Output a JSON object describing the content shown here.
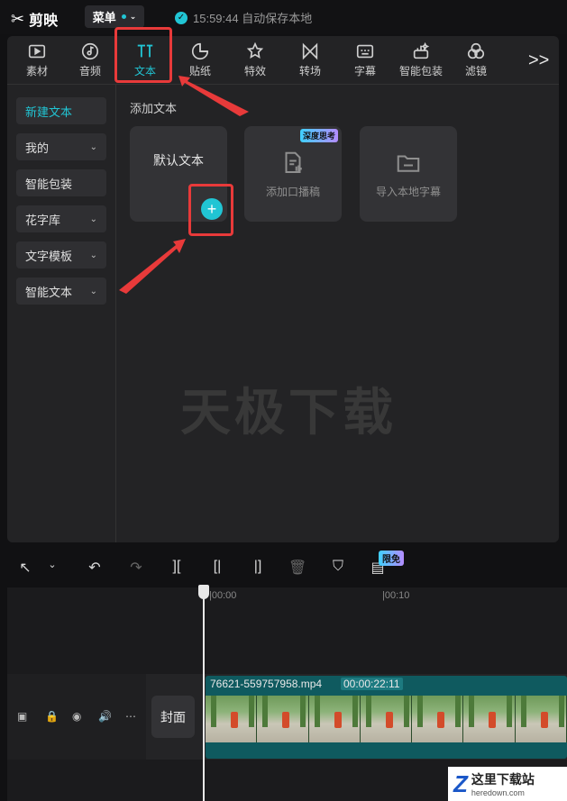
{
  "app": {
    "name": "剪映",
    "menu_label": "菜单",
    "save_status": "15:59:44 自动保存本地"
  },
  "toolbar": {
    "items": [
      {
        "label": "素材",
        "icon": "media-icon"
      },
      {
        "label": "音频",
        "icon": "audio-icon"
      },
      {
        "label": "文本",
        "icon": "text-icon",
        "active": true
      },
      {
        "label": "贴纸",
        "icon": "sticker-icon"
      },
      {
        "label": "特效",
        "icon": "effects-icon"
      },
      {
        "label": "转场",
        "icon": "transition-icon"
      },
      {
        "label": "字幕",
        "icon": "subtitle-icon"
      },
      {
        "label": "智能包装",
        "icon": "smart-pack-icon"
      },
      {
        "label": "滤镜",
        "icon": "filter-icon"
      }
    ],
    "more": ">>"
  },
  "sidebar": {
    "items": [
      {
        "label": "新建文本",
        "active": true
      },
      {
        "label": "我的",
        "has_chevron": true
      },
      {
        "label": "智能包装"
      },
      {
        "label": "花字库",
        "has_chevron": true
      },
      {
        "label": "文字模板",
        "has_chevron": true
      },
      {
        "label": "智能文本",
        "has_chevron": true
      }
    ]
  },
  "content": {
    "title": "添加文本",
    "cards": [
      {
        "label": "默认文本",
        "action": "+"
      },
      {
        "label": "添加口播稿",
        "badge": "深度思考"
      },
      {
        "label": "导入本地字幕"
      }
    ],
    "watermark": "天极下载"
  },
  "timeline": {
    "free_badge": "限免",
    "ruler": [
      "|00:00",
      "|00:10"
    ],
    "cover_label": "封面",
    "clip": {
      "name": "76621-559757958.mp4",
      "duration": "00:00:22:11"
    }
  },
  "site_logo": {
    "title": "这里下载站",
    "url": "heredown.com"
  },
  "colors": {
    "accent": "#21c5d4",
    "highlight": "#e83a3a",
    "bg": "#111113",
    "panel": "#232325"
  }
}
